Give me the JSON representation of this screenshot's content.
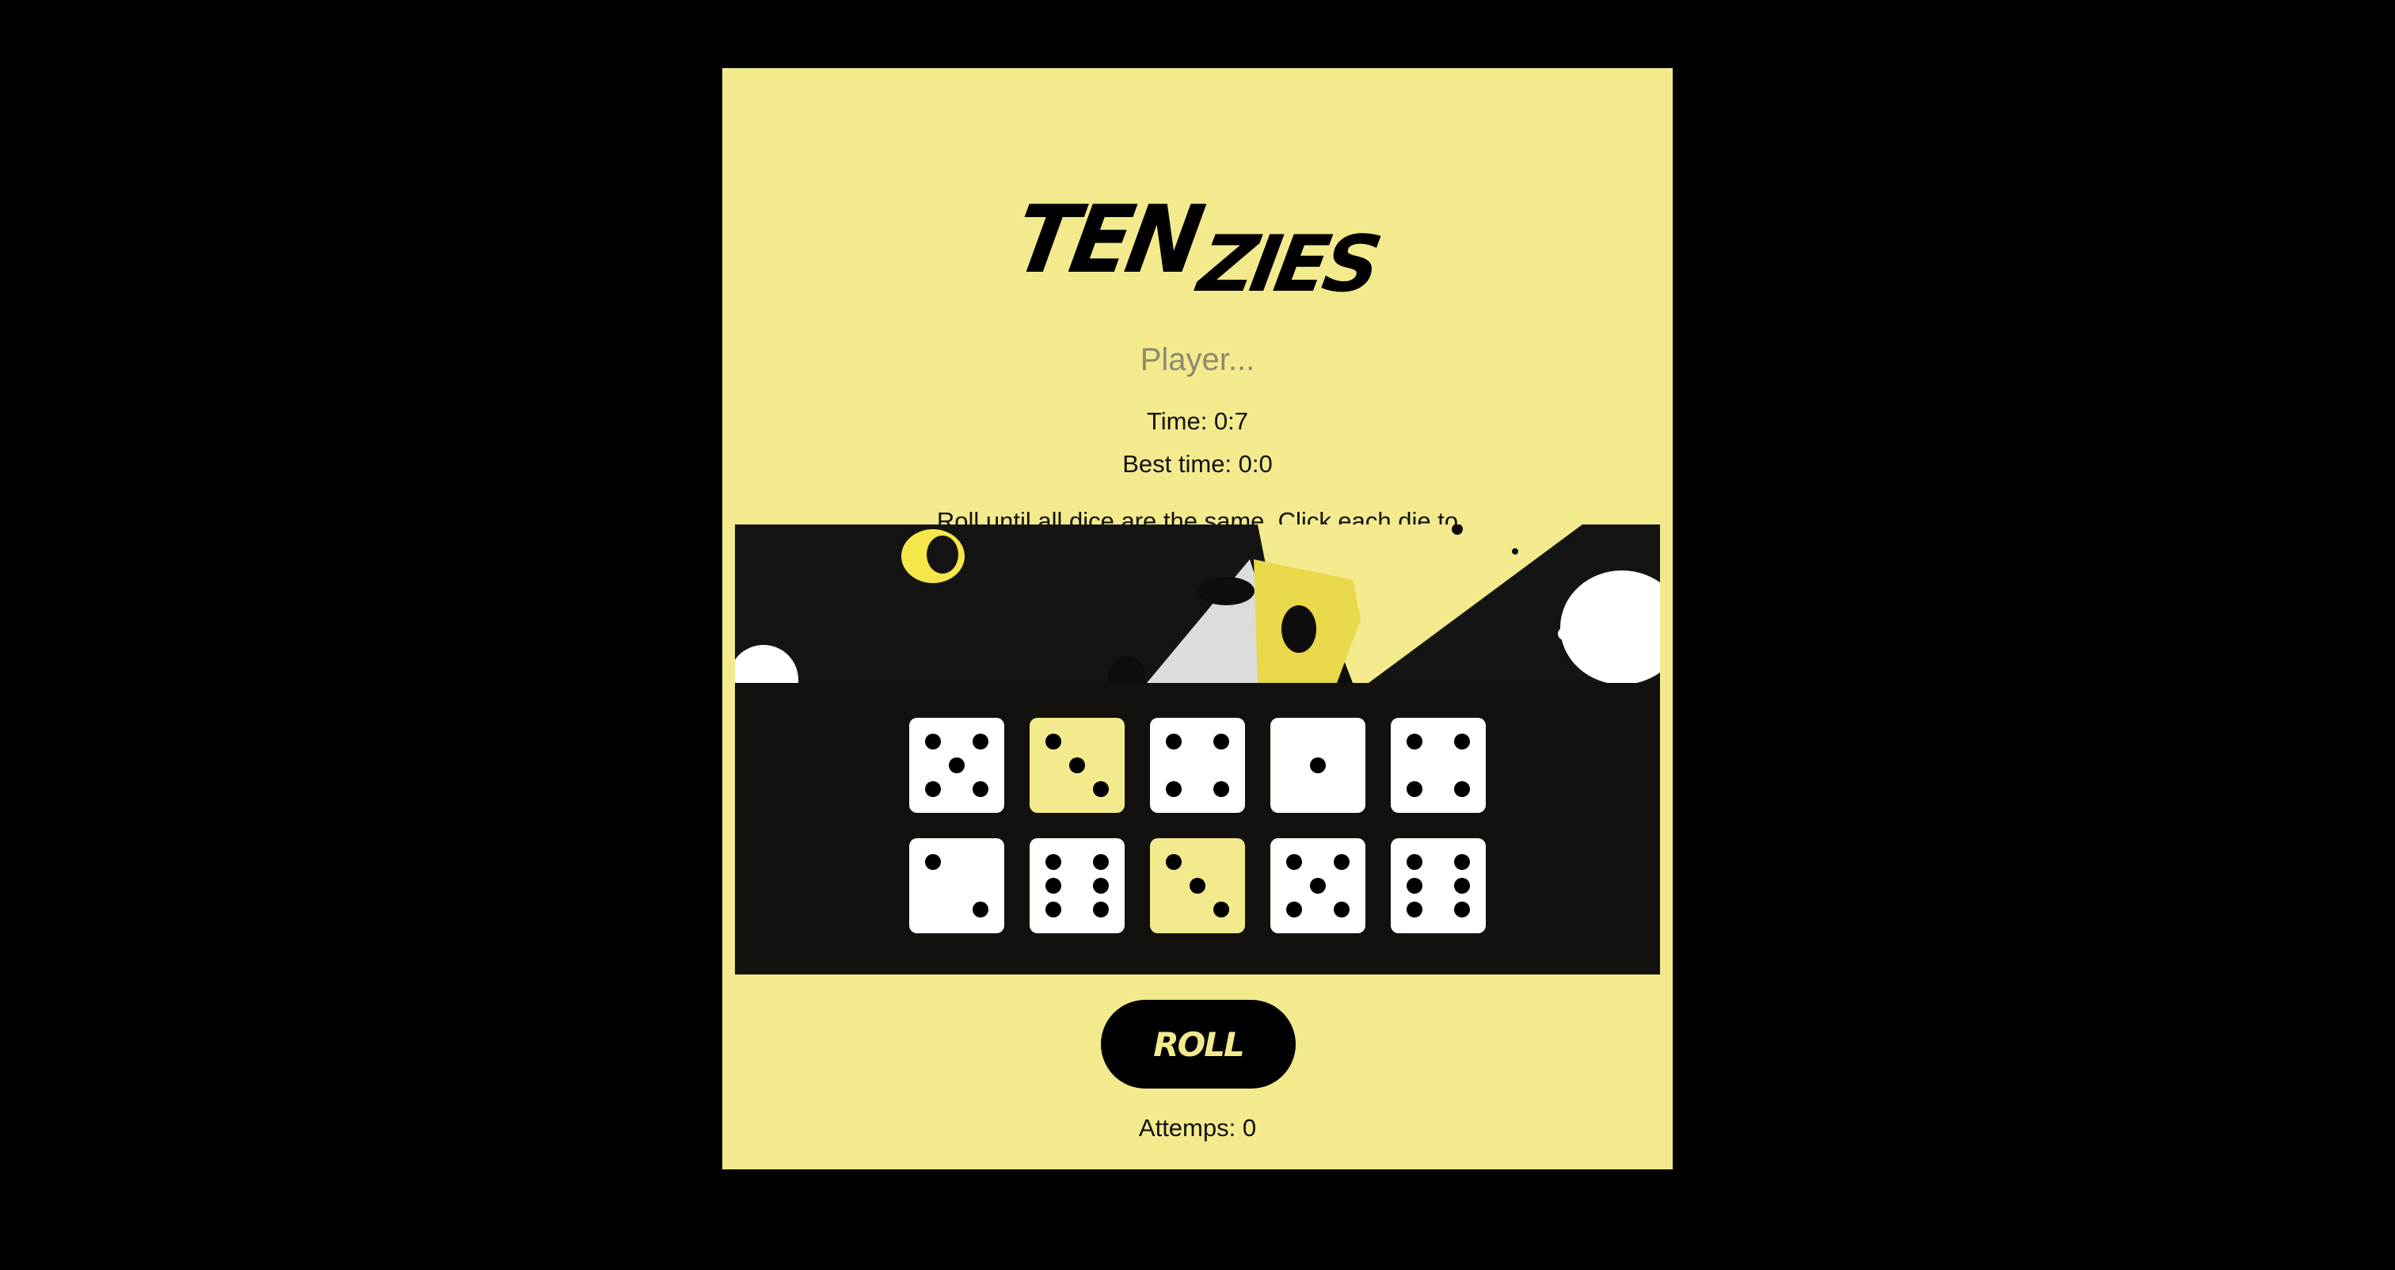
{
  "app": {
    "logo_part1": "TEN",
    "logo_part2": "ZIES",
    "player_placeholder": "Player...",
    "time_text": "Time: 0:7",
    "best_time_text": "Best time: 0:0",
    "instructions": "Roll until all dice are the same. Click each die to freeze it at its current value between rolls.",
    "roll_label": "ROLL",
    "attempts_text": "Attemps: 0"
  },
  "colors": {
    "background": "#000000",
    "card": "#f2ea8c",
    "board": "#13110d",
    "die": "#ffffff",
    "die_held": "#f2ea8c",
    "pip": "#000000"
  },
  "dice": [
    {
      "value": 5,
      "held": false
    },
    {
      "value": 3,
      "held": true
    },
    {
      "value": 4,
      "held": false
    },
    {
      "value": 1,
      "held": false
    },
    {
      "value": 4,
      "held": false
    },
    {
      "value": 2,
      "held": false
    },
    {
      "value": 6,
      "held": false
    },
    {
      "value": 3,
      "held": true
    },
    {
      "value": 5,
      "held": false
    },
    {
      "value": 6,
      "held": false
    }
  ]
}
